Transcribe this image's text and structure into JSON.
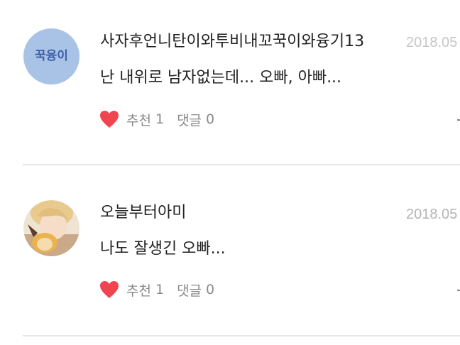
{
  "comments": [
    {
      "username": "사자후언니탄이와투비내꼬꾹이와융기13",
      "date": "2018.05",
      "text": "난 내위로 남자없는데... 오빠, 아빠...",
      "like_label": "추천",
      "like_count": "1",
      "reply_label": "댓글",
      "reply_count": "0",
      "avatar_text": "꾹융이"
    },
    {
      "username": "오늘부터아미",
      "date": "2018.05",
      "text": "나도 잘생긴 오빠...",
      "like_label": "추천",
      "like_count": "1",
      "reply_label": "댓글",
      "reply_count": "0"
    }
  ],
  "colors": {
    "heart": "#f0444f",
    "divider": "#e6e6e6",
    "meta_text": "#8a8a8a",
    "date_text": "#b4b4b4",
    "avatar1_bg": "#a9c3e6",
    "avatar1_text": "#3e5fa8"
  },
  "icons": {
    "like": "heart-icon"
  }
}
